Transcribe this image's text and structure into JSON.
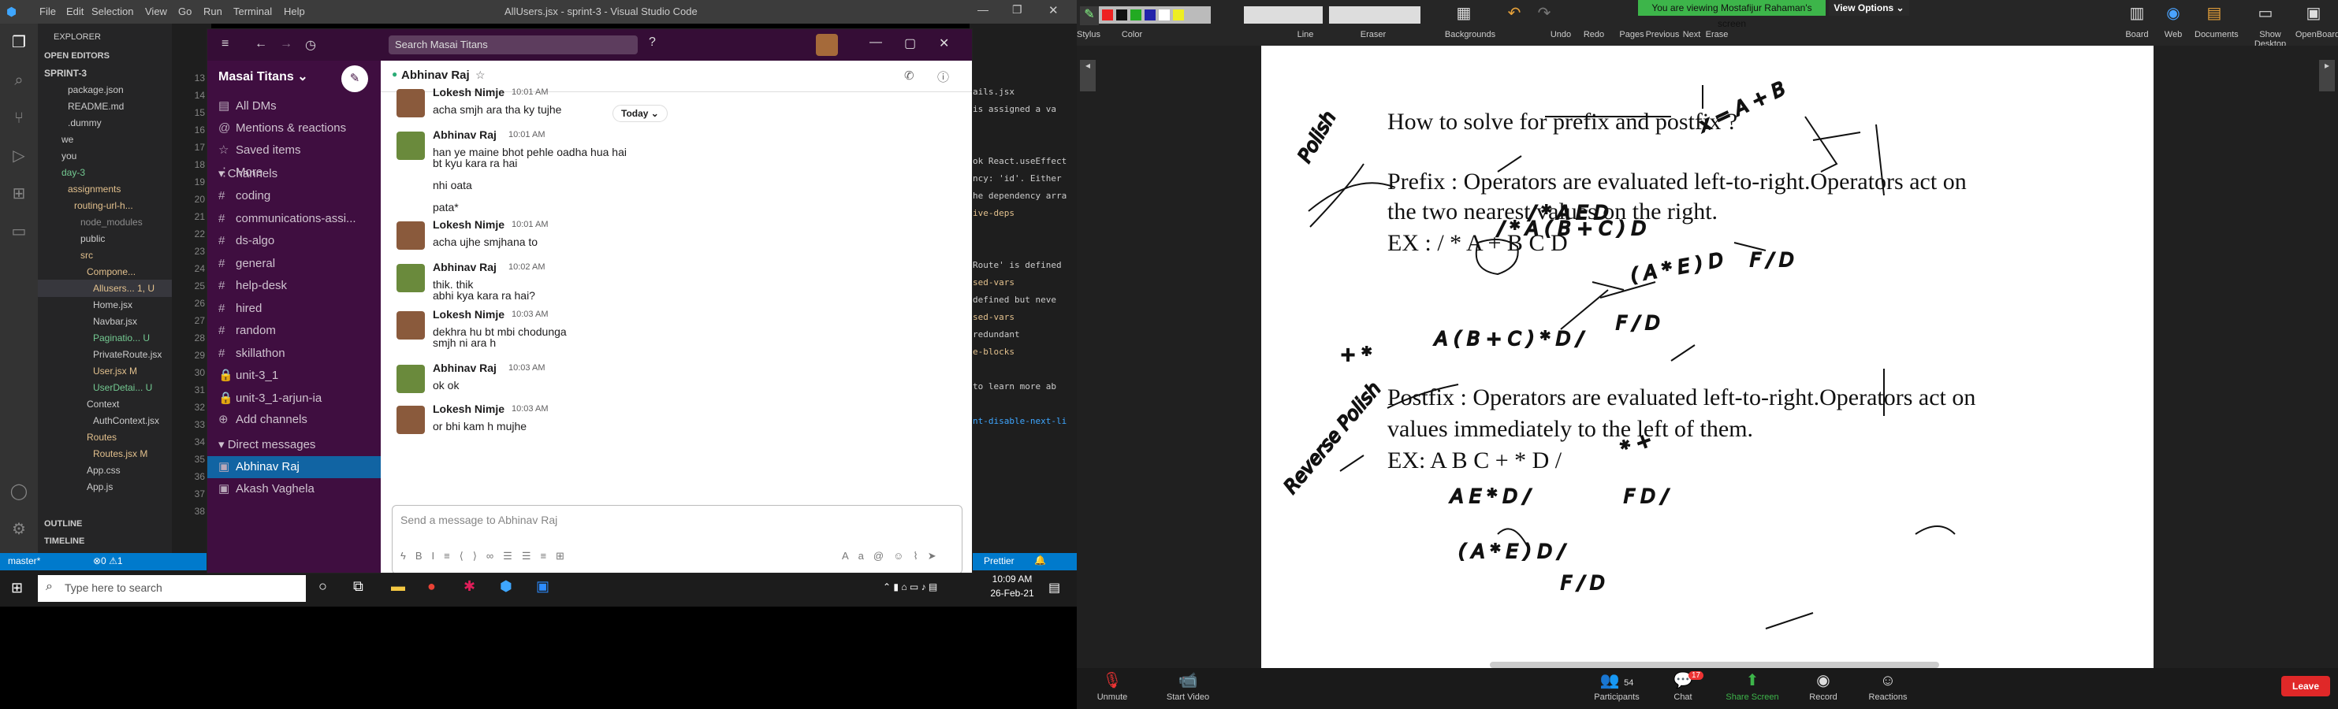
{
  "vscode": {
    "menu": [
      "File",
      "Edit",
      "Selection",
      "View",
      "Go",
      "Run",
      "Terminal",
      "Help"
    ],
    "title": "AllUsers.jsx - sprint-3 - Visual Studio Code",
    "explorer_header": "EXPLORER",
    "open_editors": "OPEN EDITORS",
    "tree": [
      {
        "label": "SPRINT-3",
        "color": "#cccccc"
      },
      {
        "label": "package.json",
        "color": "#cccccc"
      },
      {
        "label": "README.md",
        "color": "#cccccc"
      },
      {
        "label": ".dummy",
        "color": "#cccccc"
      },
      {
        "label": "we",
        "color": "#cccccc"
      },
      {
        "label": "you",
        "color": "#cccccc"
      },
      {
        "label": "day-3",
        "color": "#73c991"
      },
      {
        "label": "assignments",
        "color": "#e2c08d"
      },
      {
        "label": "routing-url-h...",
        "color": "#e2c08d"
      },
      {
        "label": "node_modules",
        "color": "#8c8c8c"
      },
      {
        "label": "public",
        "color": "#cccccc"
      },
      {
        "label": "src",
        "color": "#e2c08d"
      },
      {
        "label": "Compone...",
        "color": "#e2c08d"
      },
      {
        "label": "Allusers...  1, U",
        "color": "#e2c08d"
      },
      {
        "label": "Home.jsx",
        "color": "#cccccc"
      },
      {
        "label": "Navbar.jsx",
        "color": "#cccccc"
      },
      {
        "label": "Paginatio...  U",
        "color": "#73c991"
      },
      {
        "label": "PrivateRoute.jsx",
        "color": "#cccccc"
      },
      {
        "label": "User.jsx   M",
        "color": "#e2c08d"
      },
      {
        "label": "UserDetai...  U",
        "color": "#73c991"
      },
      {
        "label": "Context",
        "color": "#cccccc"
      },
      {
        "label": "AuthContext.jsx",
        "color": "#cccccc"
      },
      {
        "label": "Routes",
        "color": "#e2c08d"
      },
      {
        "label": "Routes.jsx   M",
        "color": "#e2c08d"
      },
      {
        "label": "App.css",
        "color": "#cccccc"
      },
      {
        "label": "App.js",
        "color": "#cccccc"
      }
    ],
    "outline": "OUTLINE",
    "timeline": "TIMELINE",
    "line_numbers": [
      "13",
      "14",
      "15",
      "16",
      "17",
      "18",
      "19",
      "20",
      "21",
      "22",
      "23",
      "24",
      "25",
      "26",
      "27",
      "28",
      "29",
      "30",
      "31",
      "32",
      "33",
      "34",
      "35",
      "36",
      "37",
      "38"
    ],
    "right_code": [
      "ails.jsx",
      "is assigned a va",
      "",
      "",
      "ok React.useEffect",
      "ncy: 'id'. Either",
      "he dependency arra",
      "ive-deps",
      "",
      "",
      "Route' is defined",
      "sed-vars",
      "defined but neve",
      "sed-vars",
      "redundant",
      "e-blocks",
      "",
      "to learn more ab",
      "",
      "nt-disable-next-li"
    ],
    "status": {
      "branch": "master*",
      "problems": "⊗0 ⚠1",
      "prettier": "Prettier"
    }
  },
  "taskbar": {
    "search_placeholder": "Type here to search",
    "time": "10:09 AM",
    "date": "26-Feb-21"
  },
  "slack": {
    "search_placeholder": "Search Masai Titans",
    "workspace": "Masai Titans",
    "nav": [
      "All DMs",
      "Mentions & reactions",
      "Saved items",
      "More"
    ],
    "channels_header": "Channels",
    "channels": [
      "coding",
      "communications-assi...",
      "ds-algo",
      "general",
      "help-desk",
      "hired",
      "random",
      "skillathon",
      "unit-3_1",
      "unit-3_1-arjun-ia"
    ],
    "add_channels": "Add channels",
    "dm_header": "Direct messages",
    "dms": [
      "Abhinav Raj",
      "Akash Vaghela"
    ],
    "channel_title": "Abhinav Raj",
    "today": "Today ⌄",
    "messages": [
      {
        "name": "Lokesh Nimje",
        "time": "10:01 AM",
        "text": "acha smjh ara tha ky tujhe"
      },
      {
        "name": "Abhinav Raj",
        "time": "10:01 AM",
        "text": "han ye maine bhot pehle oadha hua hai"
      },
      {
        "name": "",
        "time": "",
        "text": "bt kyu kara ra hai"
      },
      {
        "name": "",
        "time": "",
        "text": "nhi oata"
      },
      {
        "name": "",
        "time": "",
        "text": "pata*"
      },
      {
        "name": "Lokesh Nimje",
        "time": "10:01 AM",
        "text": "acha ujhe smjhana to"
      },
      {
        "name": "Abhinav Raj",
        "time": "10:02 AM",
        "text": "thik. thik"
      },
      {
        "name": "",
        "time": "",
        "text": "abhi kya kara ra hai?"
      },
      {
        "name": "Lokesh Nimje",
        "time": "10:03 AM",
        "text": "dekhra hu bt mbi chodunga"
      },
      {
        "name": "",
        "time": "",
        "text": "smjh ni ara h"
      },
      {
        "name": "Abhinav Raj",
        "time": "10:03 AM",
        "text": "ok ok"
      },
      {
        "name": "Lokesh Nimje",
        "time": "10:03 AM",
        "text": "or bhi kam h mujhe"
      }
    ],
    "composer_placeholder": "Send a message to Abhinav Raj"
  },
  "whiteboard": {
    "banner": "You are viewing Mostafijur Rahaman's screen",
    "view_options": "View Options ⌄",
    "tool_labels": [
      "Stylus",
      "Color",
      "Line",
      "Eraser",
      "Backgrounds",
      "Undo",
      "Redo",
      "Pages",
      "Previous",
      "Next",
      "Erase",
      "Board",
      "Web",
      "Documents",
      "Show Desktop",
      "OpenBoard"
    ],
    "lines": [
      "How to solve for prefix and postfix ?",
      "Prefix : Operators are evaluated left-to-right.Operators act on",
      "the two nearest values on the right.",
      "EX : / * A + B C D",
      "Postfix : Operators are evaluated left-to-right.Operators act on",
      "values immediately to the left of them.",
      "EX: A B C + * D /"
    ],
    "handwriting": [
      "Polish",
      "Reverse Polish",
      "x = A + B",
      "/ * A ( B + C ) D",
      "/ * A E D",
      "( A * E ) D",
      "F / D",
      "F / D",
      "A ( B + C ) * D /",
      "A E * D /",
      "( A * E ) D /",
      "F D /",
      "F / D",
      "* +",
      "+ *"
    ]
  },
  "zoom": {
    "mute": "Unmute",
    "video": "Start Video",
    "participants": "Participants",
    "participants_count": "54",
    "chat": "Chat",
    "chat_badge": "17",
    "share": "Share Screen",
    "record": "Record",
    "reactions": "Reactions",
    "leave": "Leave"
  }
}
